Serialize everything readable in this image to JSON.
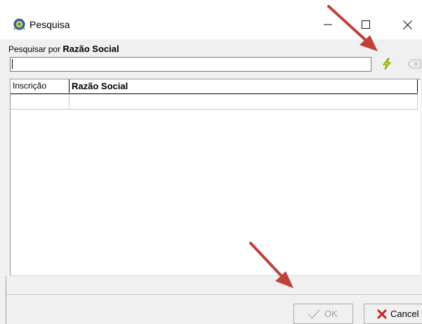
{
  "window": {
    "title": "Pesquisa",
    "controls": {
      "minimize": "—",
      "maximize": "☐",
      "close": "✕"
    }
  },
  "search": {
    "label_prefix": "Pesquisar por ",
    "field_name": "Razão Social",
    "value": ""
  },
  "grid": {
    "columns": [
      "Inscrição",
      "Razão Social"
    ],
    "rows": [
      [
        "",
        ""
      ]
    ]
  },
  "buttons": {
    "ok": "OK",
    "cancel": "Cancel"
  },
  "colors": {
    "execute_icon": "#e8c800",
    "cancel_icon": "#c82020",
    "annotation_arrow": "#c0403a"
  }
}
